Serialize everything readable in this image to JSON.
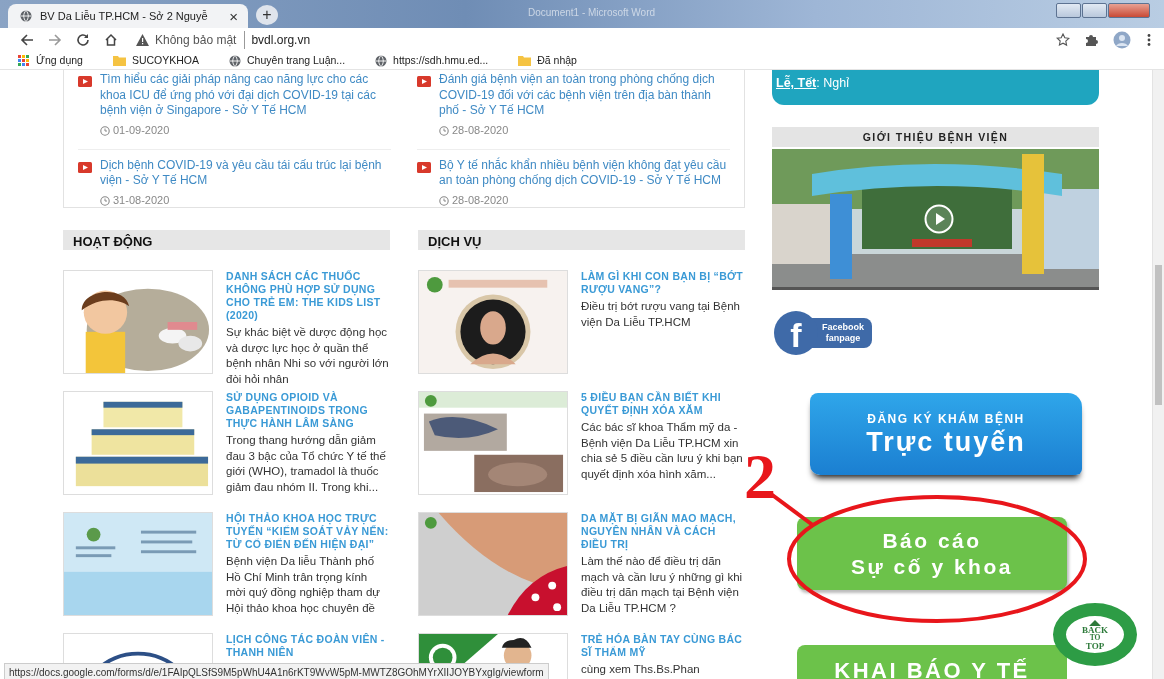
{
  "browser": {
    "tab": {
      "title": "BV Da Liễu TP.HCM - Sở 2 Nguyễ",
      "close": "×"
    },
    "new_tab": "+",
    "background_window_title": "Document1 - Microsoft Word",
    "address": {
      "security": "Không bảo mật",
      "url": "bvdl.org.vn"
    },
    "bookmarks": [
      {
        "kind": "apps",
        "label": "Ứng dụng"
      },
      {
        "kind": "folder",
        "label": "SUCOYKHOA"
      },
      {
        "kind": "site",
        "label": "Chuyên trang Luận..."
      },
      {
        "kind": "site",
        "label": "https://sdh.hmu.ed..."
      },
      {
        "kind": "folder",
        "label": "Đã nhập"
      }
    ]
  },
  "news": {
    "columns": [
      [
        {
          "title": "Tìm hiểu các giải pháp nâng cao năng lực cho các khoa ICU để ứng phó với đại dịch COVID-19 tại các bệnh viện ở Singapore - Sở Y Tế HCM",
          "date": "01-09-2020"
        },
        {
          "title": "Dịch bệnh COVID-19 và yêu cầu tái cấu trúc lại bệnh viện - Sở Y Tế HCM",
          "date": "31-08-2020"
        }
      ],
      [
        {
          "title": "Đánh giá bệnh viện an toàn trong phòng chống dịch COVID-19 đối với các bệnh viện trên địa bàn thành phố - Sở Y Tế HCM",
          "date": "28-08-2020"
        },
        {
          "title": "Bộ Y tế nhắc khẩn nhiều bệnh viện không đạt yêu cầu an toàn phòng chống dịch COVID-19 - Sở Y Tế HCM",
          "date": "28-08-2020"
        }
      ]
    ]
  },
  "sections": [
    {
      "heading": "HOẠT ĐỘNG",
      "items": [
        {
          "title": "DANH SÁCH CÁC THUỐC KHÔNG PHÙ HỢP SỬ DỤNG CHO TRẺ EM: THE KIDS LIST (2020)",
          "excerpt": "Sự khác biệt về dược động học và dược lực học ở quần thể bệnh nhân Nhi so với người lớn đòi hỏi nhân"
        },
        {
          "title": "SỬ DỤNG OPIOID VÀ GABAPENTINOIDS TRONG THỰC HÀNH LÂM SÀNG",
          "excerpt": "Trong thang hướng dẫn giảm đau 3 bậc của Tổ chức Y tế thế giới (WHO), tramadol là thuốc giảm đau nhóm II. Trong khi..."
        },
        {
          "title": "HỘI THẢO KHOA HỌC TRỰC TUYẾN “KIỂM SOÁT VẢY NẾN: TỪ CỔ ĐIỂN ĐẾN HIỆN ĐẠI”",
          "excerpt": "Bệnh viện Da liễu Thành phố Hồ Chí Minh trân trọng kính mời quý đồng nghiệp tham dự Hội thảo khoa học chuyên đề"
        },
        {
          "title": "LỊCH CÔNG TÁC ĐOÀN VIÊN - THANH NIÊN"
        }
      ]
    },
    {
      "heading": "DỊCH VỤ",
      "items": [
        {
          "title": "LÀM GÌ KHI CON BẠN BỊ “BỚT RƯỢU VANG”?",
          "excerpt": "Điều trị bớt rượu vang tại Bệnh viện Da Liễu TP.HCM"
        },
        {
          "title": "5 ĐIỀU BẠN CẦN BIẾT KHI QUYẾT ĐỊNH XÓA XĂM",
          "excerpt": "Các bác sĩ khoa Thẩm mỹ da - Bệnh viện Da Liễu TP.HCM xin chia sẻ 5 điều cần lưu ý khi bạn quyết định xóa hình xăm..."
        },
        {
          "title": "DA MẶT BỊ GIÃN MAO MẠCH, NGUYÊN NHÂN VÀ CÁCH ĐIỀU TRỊ",
          "excerpt": "Làm thế nào để điều trị dãn mạch và cần lưu ý những gì khi điều trị dãn mạch tại Bệnh viện Da Liễu TP.HCM ?"
        },
        {
          "title": "TRẺ HÓA BÀN TAY CÙNG BÁC SĨ THẨM MỸ",
          "excerpt": "cùng xem Ths.Bs.Phan"
        }
      ]
    }
  ],
  "sidebar": {
    "hours": {
      "label": "Lễ, Tết",
      "value": ": Nghỉ"
    },
    "video_heading": "GIỚI THIỆU BỆNH VIỆN",
    "banners": [
      {
        "kind": "facebook",
        "icon": "f",
        "lines": [
          "Facebook",
          "fanpage"
        ]
      },
      {
        "kind": "register",
        "lines": [
          "ĐĂNG KÝ KHÁM BỆNH",
          "Trực tuyến"
        ]
      },
      {
        "kind": "report",
        "lines": [
          "Báo cáo",
          "Sự cố y khoa"
        ]
      },
      {
        "kind": "declare",
        "lines": [
          "KHAI BÁO Y TẾ"
        ]
      }
    ]
  },
  "back_to_top": [
    "BACK",
    "TO",
    "TOP"
  ],
  "annotation": {
    "number": "2"
  },
  "status_url": "https://docs.google.com/forms/d/e/1FAIpQLSfS9M5pWhU4A1n6rKT9WvW5pM-MWTZ8GOhMYrXIIJOYBYxgIg/viewform"
}
